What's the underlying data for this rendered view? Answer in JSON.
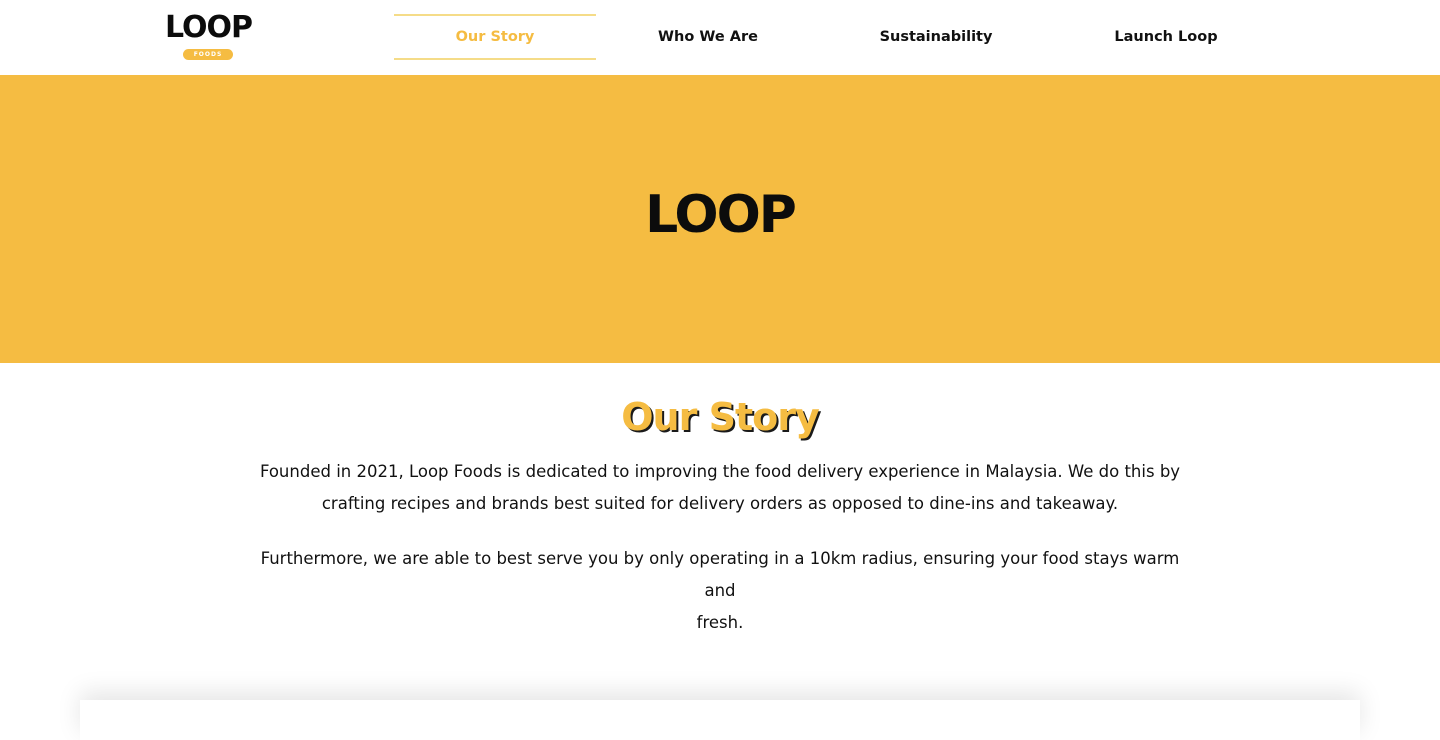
{
  "colors": {
    "accent": "#f5bc42",
    "hero_background": "#f5bc42",
    "text": "#111111",
    "background": "#ffffff"
  },
  "header": {
    "logo_word": "LOOP",
    "logo_badge": "FOODS",
    "nav": [
      {
        "label": "Our Story",
        "active": true
      },
      {
        "label": "Who We Are",
        "active": false
      },
      {
        "label": "Sustainability",
        "active": false
      },
      {
        "label": "Launch Loop",
        "active": false
      }
    ]
  },
  "hero": {
    "logo_word": "LOOP"
  },
  "story": {
    "title": "Our Story",
    "paragraph_1_line_1": "Founded in 2021, Loop Foods is dedicated to improving the food delivery experience in Malaysia. We do this by",
    "paragraph_1_line_2": "crafting recipes and brands best suited for delivery orders as opposed to dine-ins and takeaway.",
    "paragraph_2_line_1": "Furthermore, we are able to best serve you by only operating in a 10km radius, ensuring your food stays warm and",
    "paragraph_2_line_2": "fresh."
  }
}
